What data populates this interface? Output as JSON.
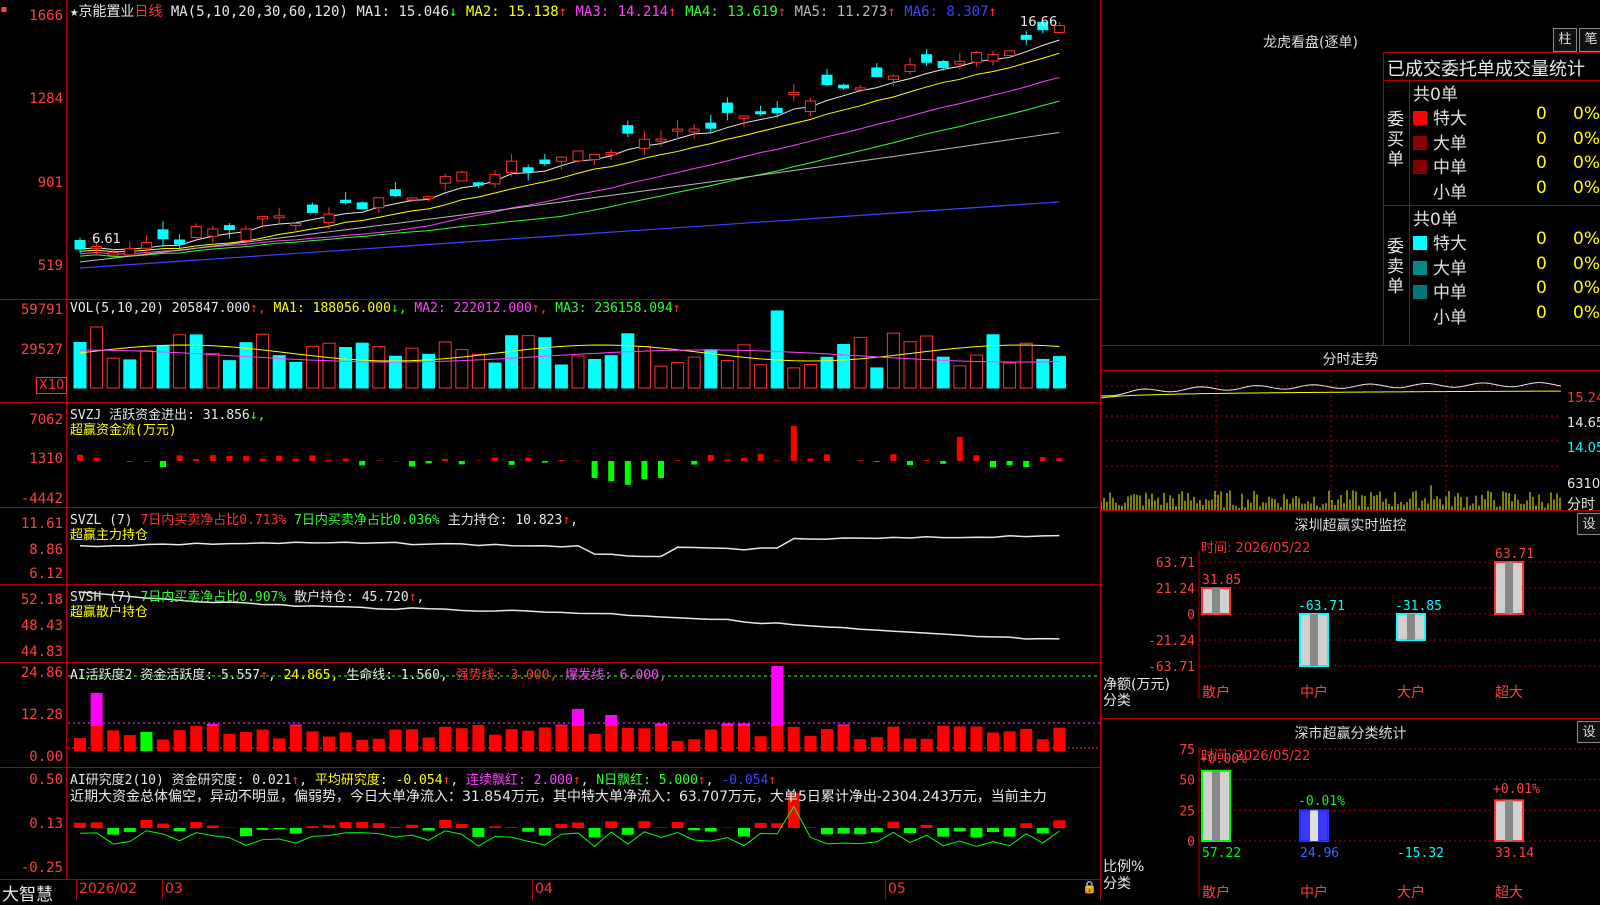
{
  "main": {
    "star": "★",
    "stock_name": "京能置业",
    "period": "日线",
    "ma_label": "MA(5,10,20,30,60,120)",
    "ma_values": [
      {
        "name": "MA1:",
        "value": "15.046",
        "arrow": "↓",
        "color": "#e8e8e8"
      },
      {
        "name": "MA2:",
        "value": "15.138",
        "arrow": "↑",
        "color": "#ffff00"
      },
      {
        "name": "MA3:",
        "value": "14.214",
        "arrow": "↑",
        "color": "#ff40ff"
      },
      {
        "name": "MA4:",
        "value": "13.619",
        "arrow": "↑",
        "color": "#30ff30"
      },
      {
        "name": "MA5:",
        "value": "11.273",
        "arrow": "↑",
        "color": "#bbbbbb"
      },
      {
        "name": "MA6:",
        "value": "8.307",
        "arrow": "↑",
        "color": "#4040ff"
      }
    ],
    "y_ticks": [
      "1666",
      "1284",
      "901",
      "519"
    ],
    "high_mark": "16.66",
    "low_mark": "6.61"
  },
  "vol": {
    "label": "VOL(5,10,20)",
    "value": "205847.000",
    "ma1": "MA1: 188056.000",
    "ma2": "MA2: 222012.000",
    "ma3": "MA3: 236158.094",
    "y_ticks": [
      "59791",
      "29527"
    ],
    "unit": "X10"
  },
  "svzj": {
    "label": "SVZJ",
    "desc": "活跃资金进出: 31.856",
    "sub": "超赢资金流(万元)",
    "y_ticks": [
      "7062",
      "1310",
      "-4442"
    ]
  },
  "svzl": {
    "label": "SVZL (7)",
    "t1": "7日内买卖净占比0.713%",
    "t2": "7日内买卖净占比0.036%",
    "t3": "主力持仓: 10.823",
    "sub": "超赢主力持仓",
    "y_ticks": [
      "11.61",
      "8.86",
      "6.12"
    ]
  },
  "svsh": {
    "label": "SVSH (7)",
    "t1": "7日内买卖净占比0.907%",
    "t2": "散户持仓: 45.720",
    "sub": "超赢散户持仓",
    "y_ticks": [
      "52.18",
      "48.43",
      "44.83"
    ]
  },
  "ai1": {
    "label": "AI活跃度2",
    "t1": "资金活跃度: 5.557",
    "t2": "24.865,",
    "t3": "生命线: 1.560,",
    "t4": "强势线: 3.000,",
    "t5": "爆发线: 6.000,",
    "y_ticks": [
      "24.86",
      "12.28",
      "0.00"
    ]
  },
  "ai2": {
    "label": "AI研究度2(10)",
    "t1": "资金研究度: 0.021",
    "t2": "平均研究度: -0.054",
    "t3": "连续飘红: 2.000",
    "t4": "N日飘红: 5.000",
    "t5": "-0.054",
    "summary": "近期大资金总体偏空，异动不明显，偏弱势，今日大单净流入：31.854万元，其中特大单净流入：63.707万元，大单5日累计净出-2304.243万元，当前主力",
    "y_ticks": [
      "0.50",
      "0.13",
      "-0.25"
    ]
  },
  "bottom": {
    "brand": "大智慧",
    "date_labels": [
      "2026/02",
      "03",
      "04",
      "05"
    ]
  },
  "right": {
    "lhb_title": "龙虎看盘(逐单)",
    "btn_zhu": "柱",
    "btn_bi": "笔",
    "stats_title": "已成交委托单成交量统计",
    "buy_label": "委买单",
    "sell_label": "委卖单",
    "buy_total": "共0单",
    "sell_total": "共0单",
    "buy_rows": [
      {
        "name": "特大",
        "count": "0",
        "pct": "0%",
        "color": "#ff0000"
      },
      {
        "name": "大单",
        "count": "0",
        "pct": "0%",
        "color": "#8b0000"
      },
      {
        "name": "中单",
        "count": "0",
        "pct": "0%",
        "color": "#800000"
      },
      {
        "name": "小单",
        "count": "0",
        "pct": "0%",
        "color": "#000000"
      }
    ],
    "sell_rows": [
      {
        "name": "特大",
        "count": "0",
        "pct": "0%",
        "color": "#00ffff"
      },
      {
        "name": "大单",
        "count": "0",
        "pct": "0%",
        "color": "#008b8b"
      },
      {
        "name": "中单",
        "count": "0",
        "pct": "0%",
        "color": "#007777"
      },
      {
        "name": "小单",
        "count": "0",
        "pct": "0%",
        "color": "#000000"
      }
    ],
    "fenshi_title": "分时走势",
    "fenshi_ticks": [
      "15.24",
      "14.65",
      "14.05"
    ],
    "fenshi_vol": "6310",
    "fenshi_unit": "分时",
    "monitor_title": "深圳超赢实时监控",
    "monitor_btn": "设",
    "monitor_time": "时间: 2026/05/22",
    "monitor_yticks": [
      "63.71",
      "21.24",
      "0",
      "-21.24",
      "-63.71"
    ],
    "monitor_ylabel": "净额(万元)",
    "monitor_xlabel": "分类",
    "monitor_cats": [
      "散户",
      "中户",
      "大户",
      "超大"
    ],
    "monitor_values": [
      "31.85",
      "-63.71",
      "-31.85",
      "63.71"
    ],
    "class_title": "深市超赢分类统计",
    "class_btn": "设",
    "class_time": "时间: 2026/05/22",
    "class_yticks": [
      "75",
      "50",
      "25",
      "0"
    ],
    "class_ylabel": "比例%",
    "class_xlabel": "分类",
    "class_top": [
      "+0.00%",
      "-0.01%",
      "",
      "+0.01%"
    ],
    "class_bottom": [
      "57.22",
      "24.96",
      "-15.32",
      "33.14"
    ],
    "class_cats": [
      "散户",
      "中户",
      "大户",
      "超大"
    ]
  }
}
